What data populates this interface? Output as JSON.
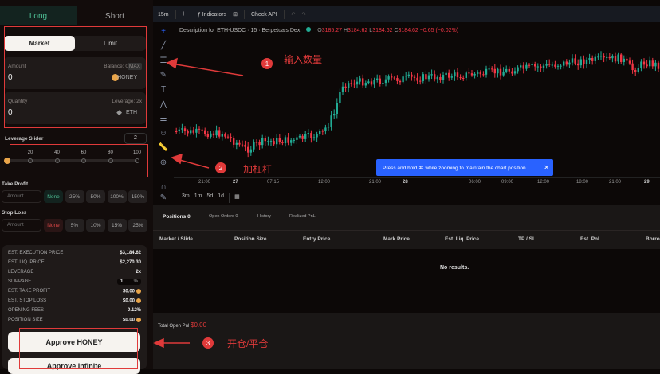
{
  "side_tabs": [
    "Long",
    "Short"
  ],
  "order_types": [
    "Market",
    "Limit"
  ],
  "amount": {
    "label": "Amount",
    "value": "0",
    "balance": "Balance: 0",
    "max": "MAX",
    "token": "HONEY"
  },
  "quantity": {
    "label": "Quantity",
    "value": "0",
    "leverage": "Leverage: 2x",
    "token": "ETH"
  },
  "leverage_slider": {
    "label": "Leverage Slider",
    "value": "2",
    "ticks": [
      "20",
      "40",
      "60",
      "80",
      "100"
    ],
    "fraction": 0.02
  },
  "take_profit": {
    "label": "Take Profit",
    "placeholder": "Amount",
    "options": [
      "None",
      "25%",
      "50%",
      "100%",
      "150%"
    ]
  },
  "stop_loss": {
    "label": "Stop Loss",
    "placeholder": "Amount",
    "options": [
      "None",
      "5%",
      "10%",
      "15%",
      "25%"
    ]
  },
  "summary": [
    {
      "k": "EST. EXECUTION PRICE",
      "v": "$3,184.62"
    },
    {
      "k": "EST. LIQ. PRICE",
      "v": "$2,270.30"
    },
    {
      "k": "LEVERAGE",
      "v": "2x"
    },
    {
      "k": "SLIPPAGE",
      "v": "1",
      "unit": "%"
    },
    {
      "k": "EST. TAKE PROFIT",
      "v": "$0.00"
    },
    {
      "k": "EST. STOP LOSS",
      "v": "$0.00"
    },
    {
      "k": "OPENING FEES",
      "v": "0.12%"
    },
    {
      "k": "POSITION SIZE",
      "v": "$0.00"
    }
  ],
  "buttons": {
    "approve": "Approve HONEY",
    "approve_inf": "Approve Infinite"
  },
  "toolbar": {
    "interval": "15m",
    "indicators": "Indicators",
    "check_api": "Check API"
  },
  "chart": {
    "title": "Description for ETH-USDC · 15 · Berpetuals Dex",
    "o": "3185.27",
    "h": "3184.62",
    "l": "3184.62",
    "c": "3184.62",
    "chg": "−0.65 (−0.02%)",
    "O": "O",
    "H": "H",
    "L": "L",
    "C": "C",
    "time_labels": [
      "21:00",
      "27",
      "07:15",
      "12:00",
      "21:00",
      "28",
      "06:00",
      "09:00",
      "12:00",
      "18:00",
      "21:00",
      "29"
    ],
    "ranges": [
      "3m",
      "1m",
      "5d",
      "1d"
    ],
    "tooltip": "Press and hold ⌘ while zooming to maintain the chart position",
    "up_color": "#22ab94",
    "down_color": "#f23645"
  },
  "positions": {
    "tabs": [
      {
        "label": "Positions",
        "count": "0"
      },
      {
        "label": "Open Orders",
        "count": "0"
      },
      {
        "label": "History"
      },
      {
        "label": "Realized PnL"
      }
    ],
    "columns": [
      "Market / Slide",
      "Position Size",
      "Entry Price",
      "Mark Price",
      "Est. Liq. Price",
      "TP / SL",
      "Est. PnL",
      "Borro"
    ],
    "empty": "No results.",
    "total_label": "Total Open Pnl",
    "total_value": "$0.00"
  },
  "annotations": [
    {
      "n": "1",
      "text": "输入数量"
    },
    {
      "n": "2",
      "text": "加杠杆"
    },
    {
      "n": "3",
      "text": "开仓/平仓"
    }
  ]
}
